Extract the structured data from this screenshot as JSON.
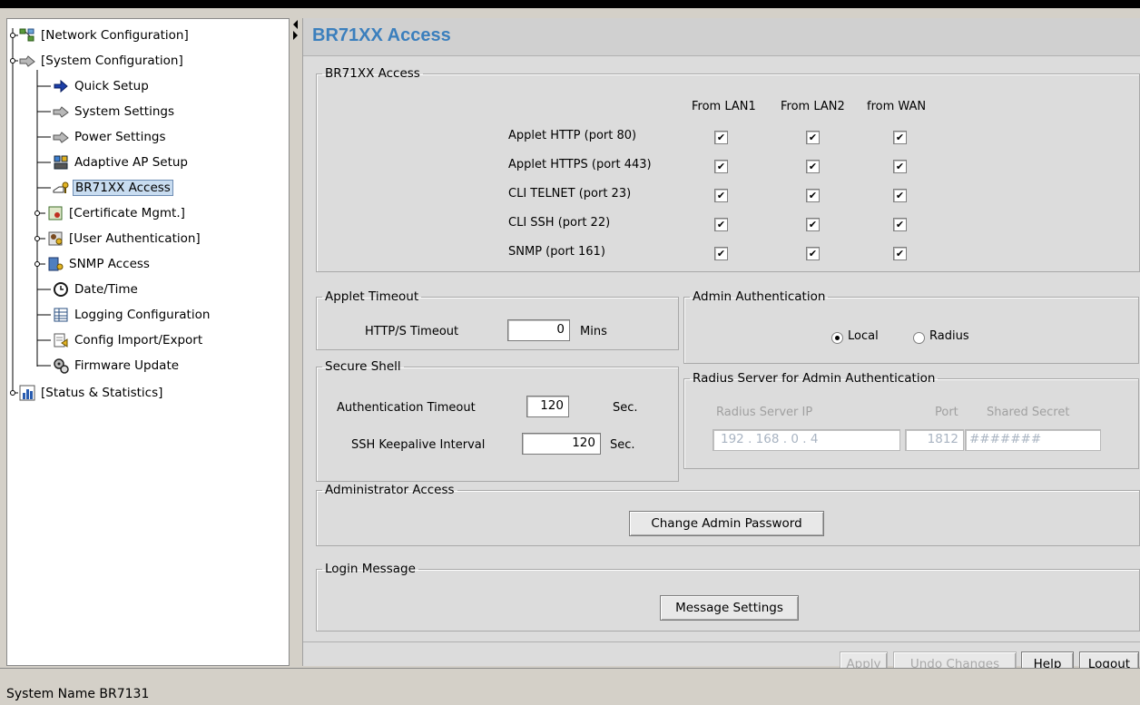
{
  "nav": {
    "items": [
      {
        "label": "[Network Configuration]"
      },
      {
        "label": "[System Configuration]"
      },
      {
        "label": "Quick Setup"
      },
      {
        "label": "System Settings"
      },
      {
        "label": "Power Settings"
      },
      {
        "label": "Adaptive AP Setup"
      },
      {
        "label": "BR71XX Access"
      },
      {
        "label": "[Certificate Mgmt.]"
      },
      {
        "label": "[User Authentication]"
      },
      {
        "label": "SNMP Access"
      },
      {
        "label": "Date/Time"
      },
      {
        "label": "Logging Configuration"
      },
      {
        "label": "Config Import/Export"
      },
      {
        "label": "Firmware Update"
      },
      {
        "label": "[Status & Statistics]"
      }
    ]
  },
  "page": {
    "title": "BR71XX Access"
  },
  "access": {
    "legend": "BR71XX Access",
    "columns": [
      "From LAN1",
      "From LAN2",
      "from WAN"
    ],
    "rows": [
      {
        "label": "Applet HTTP (port 80)",
        "checks": [
          true,
          true,
          true
        ]
      },
      {
        "label": "Applet HTTPS (port 443)",
        "checks": [
          true,
          true,
          true
        ]
      },
      {
        "label": "CLI TELNET (port 23)",
        "checks": [
          true,
          true,
          true
        ]
      },
      {
        "label": "CLI SSH (port 22)",
        "checks": [
          true,
          true,
          true
        ]
      },
      {
        "label": "SNMP (port 161)",
        "checks": [
          true,
          true,
          true
        ]
      }
    ]
  },
  "applet_timeout": {
    "legend": "Applet Timeout",
    "label": "HTTP/S Timeout",
    "value": "0",
    "unit": "Mins"
  },
  "admin_auth": {
    "legend": "Admin Authentication",
    "local_label": "Local",
    "radius_label": "Radius",
    "selected": "Local"
  },
  "secure_shell": {
    "legend": "Secure Shell",
    "auth_timeout_label": "Authentication Timeout",
    "auth_timeout_value": "120",
    "auth_timeout_unit": "Sec.",
    "keepalive_label": "SSH Keepalive Interval",
    "keepalive_value": "120",
    "keepalive_unit": "Sec."
  },
  "radius_server": {
    "legend": "Radius Server for Admin Authentication",
    "ip_label": "Radius Server IP",
    "port_label": "Port",
    "secret_label": "Shared Secret",
    "ip_octets": [
      "192",
      "168",
      "0",
      "4"
    ],
    "ip_sep": ".",
    "port_value": "1812",
    "secret_value": "#######"
  },
  "admin_access": {
    "legend": "Administrator Access",
    "button": "Change Admin Password"
  },
  "login_message": {
    "legend": "Login Message",
    "button": "Message Settings"
  },
  "footer": {
    "apply": "Apply",
    "undo": "Undo Changes",
    "help": "Help",
    "logout": "Logout"
  },
  "status": {
    "text": "System Name BR7131"
  },
  "colors": {
    "title": "#3b7fbd",
    "selected_bg": "#c8dcf0",
    "panel_bg": "#dcdcdc"
  }
}
